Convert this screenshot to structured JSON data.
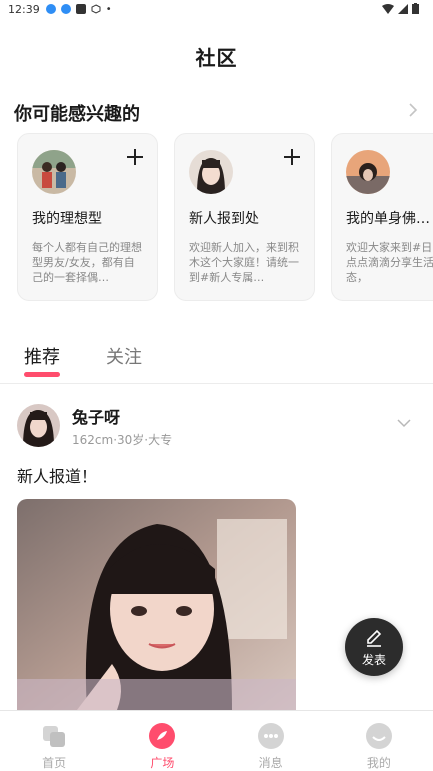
{
  "status_bar": {
    "time": "12:39"
  },
  "page": {
    "title": "社区"
  },
  "interest": {
    "title": "你可能感兴趣的",
    "cards": [
      {
        "name": "我的理想型",
        "desc": "每个人都有自己的理想型男友/女友，都有自己的一套择偶…"
      },
      {
        "name": "新人报到处",
        "desc": "欢迎新人加入，来到积木这个大家庭！请统一到#新人专属…"
      },
      {
        "name": "我的单身佛…",
        "desc": "欢迎大家来到#日常，点点滴滴分享生活百态，"
      }
    ]
  },
  "tabs": [
    {
      "label": "推荐"
    },
    {
      "label": "关注"
    }
  ],
  "post": {
    "username": "兔子呀",
    "meta": "162cm·30岁·大专",
    "text": "新人报道！"
  },
  "fab": {
    "label": "发表"
  },
  "tabbar": [
    {
      "label": "首页",
      "icon": "home-icon"
    },
    {
      "label": "广场",
      "icon": "plaza-icon"
    },
    {
      "label": "消息",
      "icon": "message-icon"
    },
    {
      "label": "我的",
      "icon": "profile-icon"
    }
  ],
  "colors": {
    "accent": "#ff4d6d",
    "fab": "#2c2c2c"
  }
}
